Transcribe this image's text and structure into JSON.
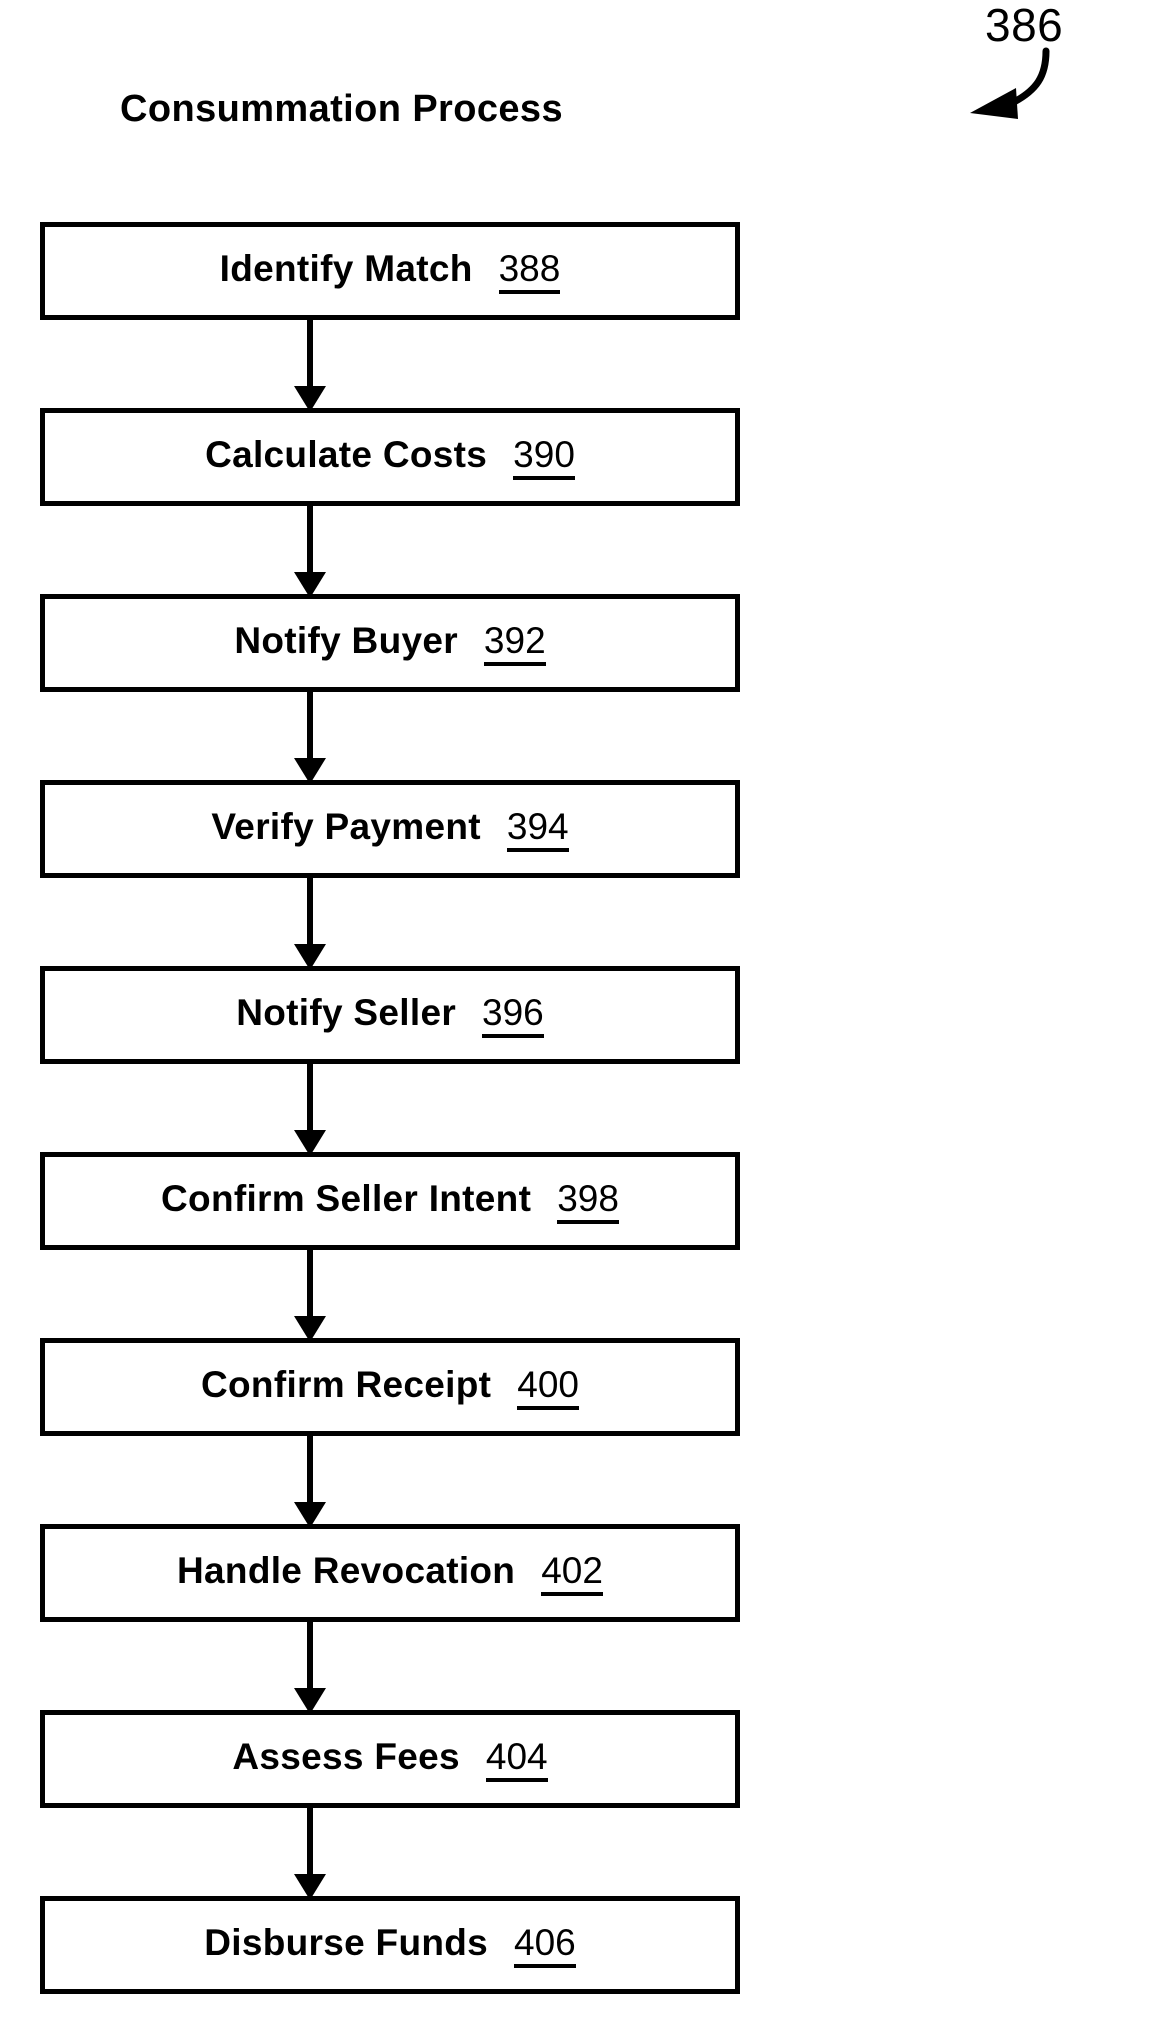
{
  "figure": {
    "reference_numeral": "386",
    "title": "Consummation Process",
    "lead_arrow_icon": "curved-arrow-icon"
  },
  "flow": {
    "orientation": "vertical",
    "steps": [
      {
        "label": "Identify Match",
        "number": "388"
      },
      {
        "label": "Calculate Costs",
        "number": "390"
      },
      {
        "label": "Notify Buyer",
        "number": "392"
      },
      {
        "label": "Verify Payment",
        "number": "394"
      },
      {
        "label": "Notify Seller",
        "number": "396"
      },
      {
        "label": "Confirm Seller Intent",
        "number": "398"
      },
      {
        "label": "Confirm Receipt",
        "number": "400"
      },
      {
        "label": "Handle Revocation",
        "number": "402"
      },
      {
        "label": "Assess Fees",
        "number": "404"
      },
      {
        "label": "Disburse Funds",
        "number": "406"
      }
    ],
    "connector_icon": "down-arrow-icon",
    "connector_count": 9
  },
  "style": {
    "ink_color": "#000000",
    "paper_color": "#ffffff"
  }
}
